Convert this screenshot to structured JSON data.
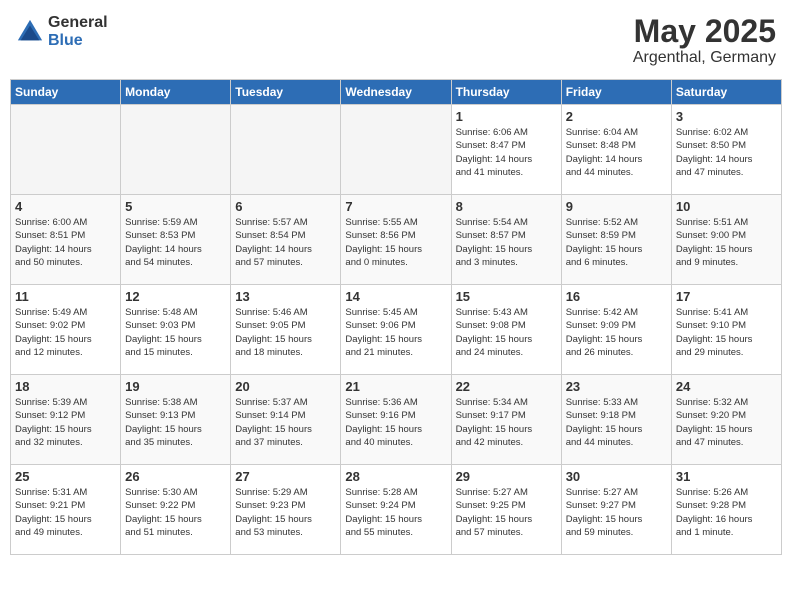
{
  "header": {
    "logo_general": "General",
    "logo_blue": "Blue",
    "month": "May 2025",
    "location": "Argenthal, Germany"
  },
  "weekdays": [
    "Sunday",
    "Monday",
    "Tuesday",
    "Wednesday",
    "Thursday",
    "Friday",
    "Saturday"
  ],
  "weeks": [
    [
      {
        "day": "",
        "info": ""
      },
      {
        "day": "",
        "info": ""
      },
      {
        "day": "",
        "info": ""
      },
      {
        "day": "",
        "info": ""
      },
      {
        "day": "1",
        "info": "Sunrise: 6:06 AM\nSunset: 8:47 PM\nDaylight: 14 hours\nand 41 minutes."
      },
      {
        "day": "2",
        "info": "Sunrise: 6:04 AM\nSunset: 8:48 PM\nDaylight: 14 hours\nand 44 minutes."
      },
      {
        "day": "3",
        "info": "Sunrise: 6:02 AM\nSunset: 8:50 PM\nDaylight: 14 hours\nand 47 minutes."
      }
    ],
    [
      {
        "day": "4",
        "info": "Sunrise: 6:00 AM\nSunset: 8:51 PM\nDaylight: 14 hours\nand 50 minutes."
      },
      {
        "day": "5",
        "info": "Sunrise: 5:59 AM\nSunset: 8:53 PM\nDaylight: 14 hours\nand 54 minutes."
      },
      {
        "day": "6",
        "info": "Sunrise: 5:57 AM\nSunset: 8:54 PM\nDaylight: 14 hours\nand 57 minutes."
      },
      {
        "day": "7",
        "info": "Sunrise: 5:55 AM\nSunset: 8:56 PM\nDaylight: 15 hours\nand 0 minutes."
      },
      {
        "day": "8",
        "info": "Sunrise: 5:54 AM\nSunset: 8:57 PM\nDaylight: 15 hours\nand 3 minutes."
      },
      {
        "day": "9",
        "info": "Sunrise: 5:52 AM\nSunset: 8:59 PM\nDaylight: 15 hours\nand 6 minutes."
      },
      {
        "day": "10",
        "info": "Sunrise: 5:51 AM\nSunset: 9:00 PM\nDaylight: 15 hours\nand 9 minutes."
      }
    ],
    [
      {
        "day": "11",
        "info": "Sunrise: 5:49 AM\nSunset: 9:02 PM\nDaylight: 15 hours\nand 12 minutes."
      },
      {
        "day": "12",
        "info": "Sunrise: 5:48 AM\nSunset: 9:03 PM\nDaylight: 15 hours\nand 15 minutes."
      },
      {
        "day": "13",
        "info": "Sunrise: 5:46 AM\nSunset: 9:05 PM\nDaylight: 15 hours\nand 18 minutes."
      },
      {
        "day": "14",
        "info": "Sunrise: 5:45 AM\nSunset: 9:06 PM\nDaylight: 15 hours\nand 21 minutes."
      },
      {
        "day": "15",
        "info": "Sunrise: 5:43 AM\nSunset: 9:08 PM\nDaylight: 15 hours\nand 24 minutes."
      },
      {
        "day": "16",
        "info": "Sunrise: 5:42 AM\nSunset: 9:09 PM\nDaylight: 15 hours\nand 26 minutes."
      },
      {
        "day": "17",
        "info": "Sunrise: 5:41 AM\nSunset: 9:10 PM\nDaylight: 15 hours\nand 29 minutes."
      }
    ],
    [
      {
        "day": "18",
        "info": "Sunrise: 5:39 AM\nSunset: 9:12 PM\nDaylight: 15 hours\nand 32 minutes."
      },
      {
        "day": "19",
        "info": "Sunrise: 5:38 AM\nSunset: 9:13 PM\nDaylight: 15 hours\nand 35 minutes."
      },
      {
        "day": "20",
        "info": "Sunrise: 5:37 AM\nSunset: 9:14 PM\nDaylight: 15 hours\nand 37 minutes."
      },
      {
        "day": "21",
        "info": "Sunrise: 5:36 AM\nSunset: 9:16 PM\nDaylight: 15 hours\nand 40 minutes."
      },
      {
        "day": "22",
        "info": "Sunrise: 5:34 AM\nSunset: 9:17 PM\nDaylight: 15 hours\nand 42 minutes."
      },
      {
        "day": "23",
        "info": "Sunrise: 5:33 AM\nSunset: 9:18 PM\nDaylight: 15 hours\nand 44 minutes."
      },
      {
        "day": "24",
        "info": "Sunrise: 5:32 AM\nSunset: 9:20 PM\nDaylight: 15 hours\nand 47 minutes."
      }
    ],
    [
      {
        "day": "25",
        "info": "Sunrise: 5:31 AM\nSunset: 9:21 PM\nDaylight: 15 hours\nand 49 minutes."
      },
      {
        "day": "26",
        "info": "Sunrise: 5:30 AM\nSunset: 9:22 PM\nDaylight: 15 hours\nand 51 minutes."
      },
      {
        "day": "27",
        "info": "Sunrise: 5:29 AM\nSunset: 9:23 PM\nDaylight: 15 hours\nand 53 minutes."
      },
      {
        "day": "28",
        "info": "Sunrise: 5:28 AM\nSunset: 9:24 PM\nDaylight: 15 hours\nand 55 minutes."
      },
      {
        "day": "29",
        "info": "Sunrise: 5:27 AM\nSunset: 9:25 PM\nDaylight: 15 hours\nand 57 minutes."
      },
      {
        "day": "30",
        "info": "Sunrise: 5:27 AM\nSunset: 9:27 PM\nDaylight: 15 hours\nand 59 minutes."
      },
      {
        "day": "31",
        "info": "Sunrise: 5:26 AM\nSunset: 9:28 PM\nDaylight: 16 hours\nand 1 minute."
      }
    ]
  ]
}
